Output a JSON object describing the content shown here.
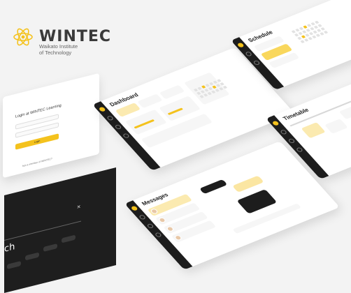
{
  "brand": {
    "name": "WINTEC",
    "subtitle_line1": "Waikato Institute",
    "subtitle_line2": "of Technology",
    "accent": "#f4c21d"
  },
  "login": {
    "title": "Login at WINTEC Learning",
    "button": "Login",
    "footer": "Not a member of WINTEC?"
  },
  "search": {
    "word": "ch",
    "close": "×"
  },
  "dashboard": {
    "title": "Dashboard"
  },
  "schedule": {
    "title": "Schedule"
  },
  "timetable": {
    "title": "Timetable"
  },
  "messages": {
    "title": "Messages"
  }
}
